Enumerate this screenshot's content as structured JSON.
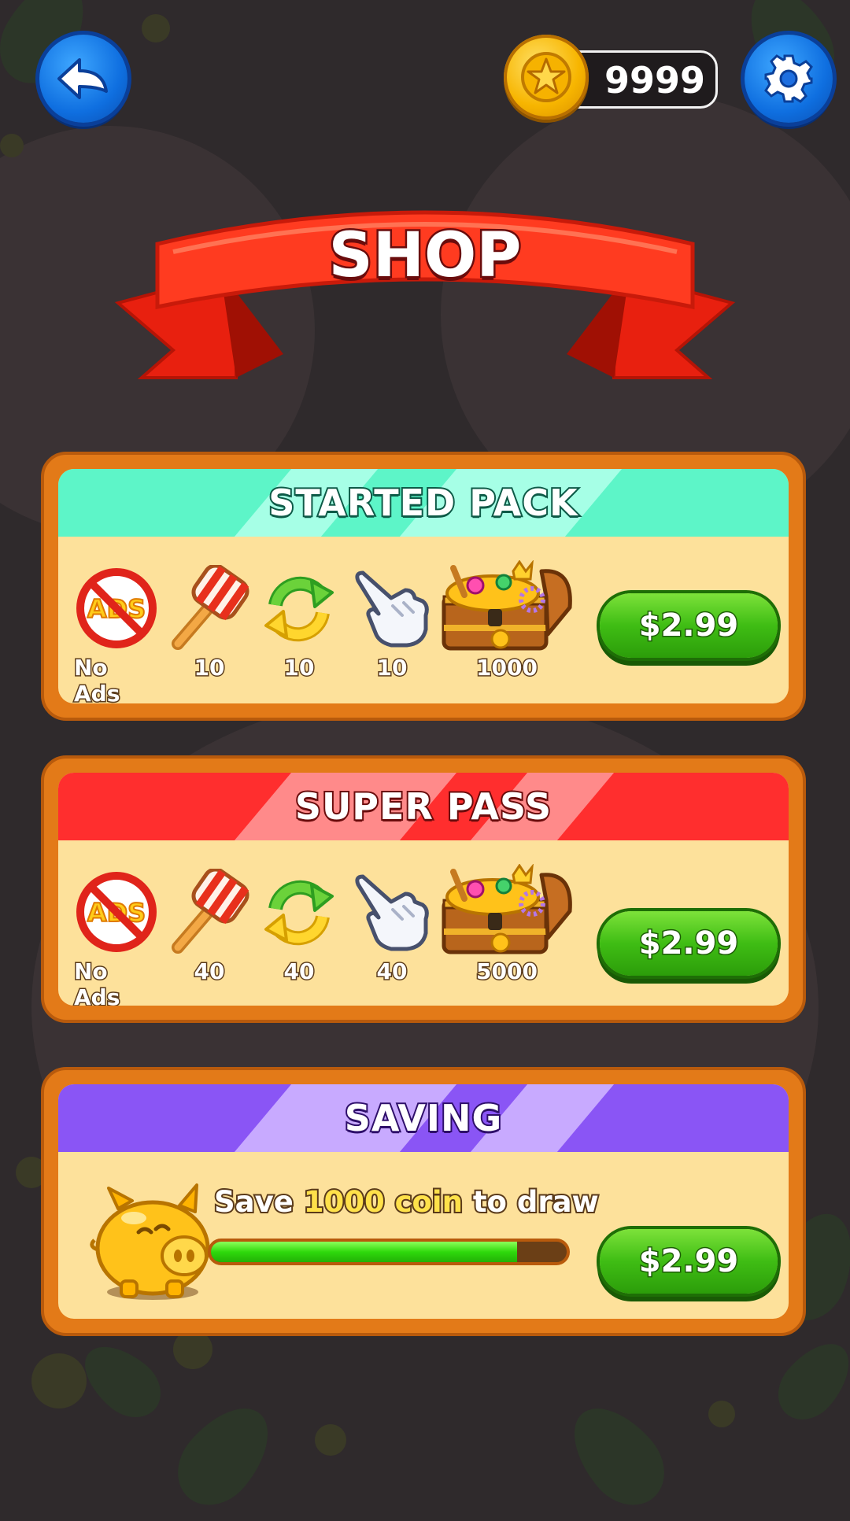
{
  "header": {
    "back_icon": "back-arrow-icon",
    "settings_icon": "gear-icon",
    "coin_icon": "star-coin-icon",
    "coins": "9999"
  },
  "title": "SHOP",
  "packs": [
    {
      "title": "STARTED PACK",
      "header_color": "#5df5c8",
      "items": [
        {
          "icon": "no-ads-icon",
          "label": "No Ads"
        },
        {
          "icon": "hammer-icon",
          "label": "10"
        },
        {
          "icon": "refresh-arrows-icon",
          "label": "10"
        },
        {
          "icon": "pointing-glove-icon",
          "label": "10"
        },
        {
          "icon": "treasure-chest-icon",
          "label": "1000"
        }
      ],
      "price": "$2.99"
    },
    {
      "title": "SUPER PASS",
      "header_color": "#ff2e2e",
      "items": [
        {
          "icon": "no-ads-icon",
          "label": "No Ads"
        },
        {
          "icon": "hammer-icon",
          "label": "40"
        },
        {
          "icon": "refresh-arrows-icon",
          "label": "40"
        },
        {
          "icon": "pointing-glove-icon",
          "label": "40"
        },
        {
          "icon": "treasure-chest-icon",
          "label": "5000"
        }
      ],
      "price": "$2.99"
    }
  ],
  "saving": {
    "title": "SAVING",
    "header_color": "#8a55f5",
    "icon": "piggy-bank-icon",
    "text_before": "Save ",
    "text_highlight": "1000 coin",
    "text_after": " to draw",
    "progress": 0.86,
    "price": "$2.99"
  }
}
